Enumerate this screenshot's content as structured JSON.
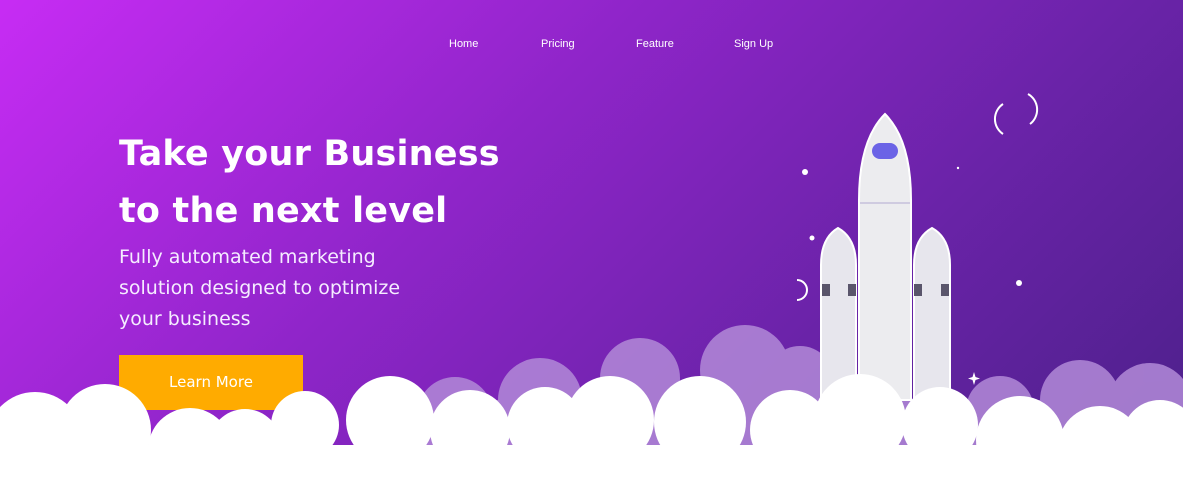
{
  "nav": {
    "items": [
      {
        "label": "Home"
      },
      {
        "label": "Pricing"
      },
      {
        "label": "Feature"
      },
      {
        "label": "Sign Up"
      }
    ]
  },
  "hero": {
    "headline_lines": [
      "Take your Business",
      "to the next level"
    ],
    "subtext_lines": [
      "Fully automated marketing",
      "solution designed to optimize",
      "your business"
    ],
    "cta_label": "Learn More"
  },
  "colors": {
    "gradient_start": "#c72cf4",
    "gradient_end": "#4a2088",
    "cta": "#ffab00",
    "rocket_window": "#6b63e6",
    "rocket_body": "#ececef"
  },
  "icons": [
    "rocket-illustration",
    "cloud-decoration",
    "star-decoration"
  ]
}
